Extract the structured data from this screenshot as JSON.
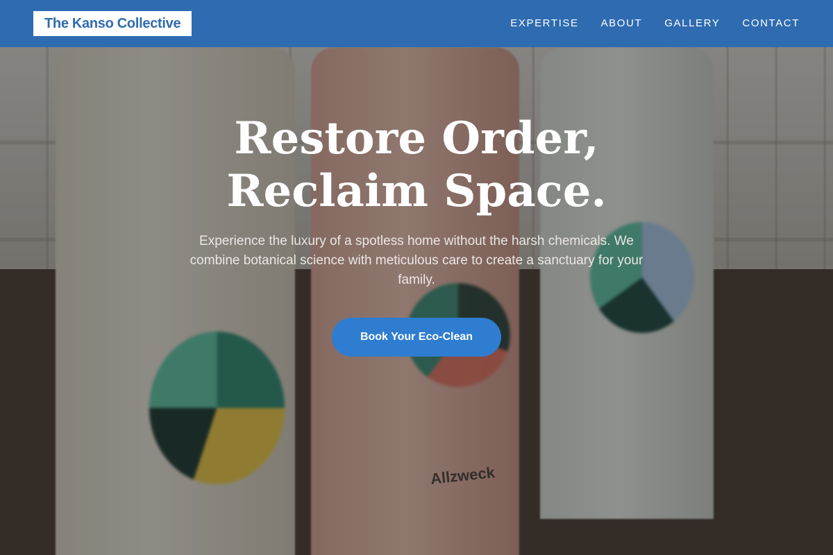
{
  "header": {
    "brand": "The Kanso Collective",
    "nav": [
      {
        "label": "EXPERTISE"
      },
      {
        "label": "ABOUT"
      },
      {
        "label": "GALLERY"
      },
      {
        "label": "CONTACT"
      }
    ]
  },
  "hero": {
    "title": "Restore Order, Reclaim Space.",
    "subtitle": "Experience the luxury of a spotless home without the harsh chemicals. We combine botanical science with meticulous care to create a sanctuary for your family.",
    "cta_label": "Book Your Eco-Clean",
    "image_text": "Allzweck"
  },
  "colors": {
    "header_bg": "#2f6bb0",
    "brand_text": "#2f6bb0",
    "cta_bg": "#2e7dd1",
    "hero_text": "#ffffff"
  }
}
